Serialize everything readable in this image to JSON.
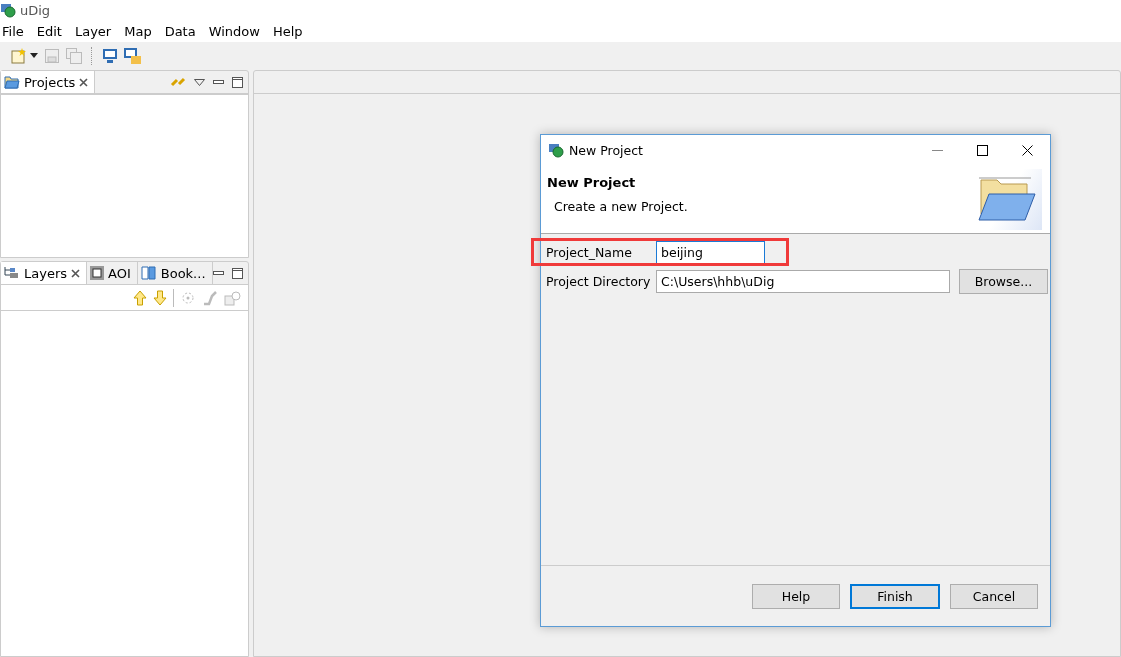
{
  "window": {
    "title": "uDig"
  },
  "menu": [
    "File",
    "Edit",
    "Layer",
    "Map",
    "Data",
    "Window",
    "Help"
  ],
  "projects_view": {
    "tabs": [
      {
        "label": "Projects",
        "selected": true
      }
    ]
  },
  "layers_view": {
    "tabs": [
      {
        "label": "Layers",
        "selected": true
      },
      {
        "label": "AOI",
        "selected": false
      },
      {
        "label": "Book...",
        "selected": false
      }
    ]
  },
  "dialog": {
    "title": "New Project",
    "heading": "New Project",
    "description": "Create a new Project.",
    "fields": [
      {
        "label": "Project_Name",
        "value": "beijing",
        "focused": true
      },
      {
        "label": "Project Directory",
        "value": "C:\\Users\\hhb\\uDig",
        "focused": false
      }
    ],
    "browse_button": "Browse...",
    "buttons": [
      {
        "label": "Help",
        "default": false
      },
      {
        "label": "Finish",
        "default": true
      },
      {
        "label": "Cancel",
        "default": false
      }
    ]
  }
}
